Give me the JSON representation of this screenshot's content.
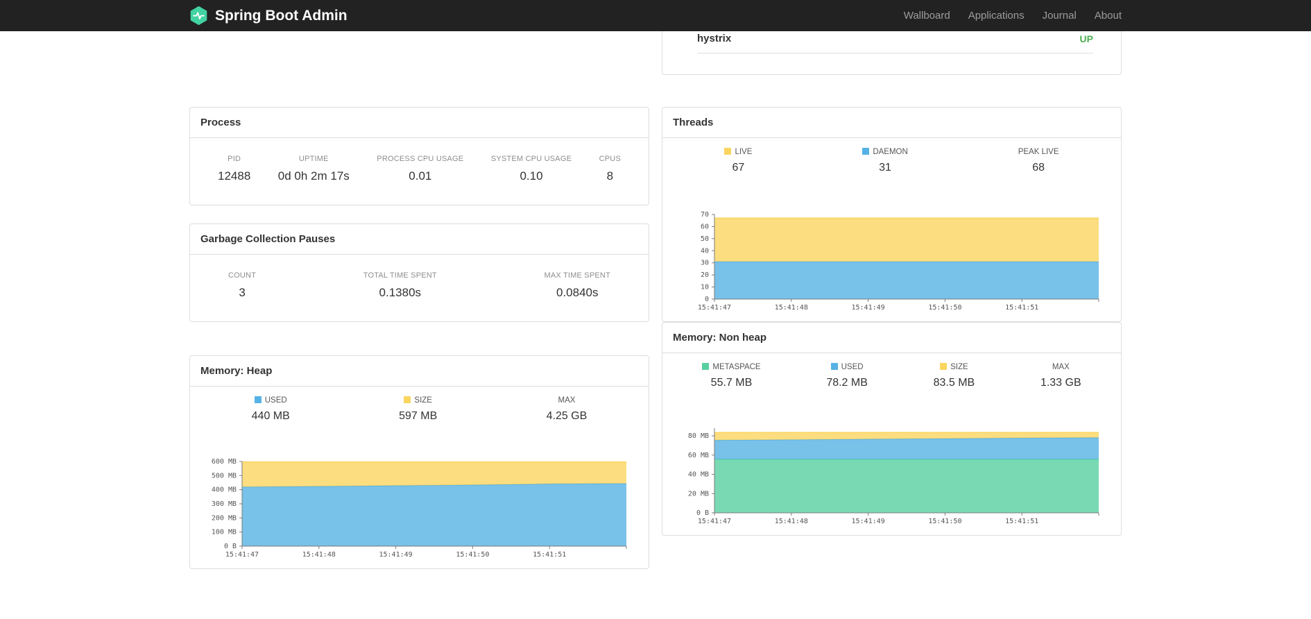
{
  "navbar": {
    "brand": "Spring Boot Admin",
    "links": [
      {
        "label": "Wallboard"
      },
      {
        "label": "Applications"
      },
      {
        "label": "Journal"
      },
      {
        "label": "About"
      }
    ]
  },
  "colors": {
    "navbar_bg": "#222222",
    "logo_green": "#42d3a2",
    "status_up_green": "#4caf50",
    "chart_blue": "#56b2e4",
    "chart_yellow": "#fbd55f",
    "chart_green": "#57d0a0",
    "panel_border": "#dddddd"
  },
  "application": {
    "name": "hystrix",
    "status": "UP",
    "status_color": "#4caf50"
  },
  "panels": {
    "process": {
      "title": "Process",
      "metrics": [
        {
          "label": "PID",
          "value": "12488"
        },
        {
          "label": "UPTIME",
          "value": "0d 0h 2m 17s"
        },
        {
          "label": "PROCESS CPU USAGE",
          "value": "0.01"
        },
        {
          "label": "SYSTEM CPU USAGE",
          "value": "0.10"
        },
        {
          "label": "CPUS",
          "value": "8"
        }
      ]
    },
    "gc": {
      "title": "Garbage Collection Pauses",
      "metrics": [
        {
          "label": "COUNT",
          "value": "3"
        },
        {
          "label": "TOTAL TIME SPENT",
          "value": "0.1380s"
        },
        {
          "label": "MAX TIME SPENT",
          "value": "0.0840s"
        }
      ]
    },
    "threads": {
      "title": "Threads",
      "legend": [
        {
          "label": "LIVE",
          "value": "67",
          "color": "#fbd55f"
        },
        {
          "label": "DAEMON",
          "value": "31",
          "color": "#56b2e4"
        },
        {
          "label": "PEAK LIVE",
          "value": "68"
        }
      ]
    },
    "heap": {
      "title": "Memory: Heap",
      "legend": [
        {
          "label": "USED",
          "value": "440 MB",
          "color": "#56b2e4"
        },
        {
          "label": "SIZE",
          "value": "597 MB",
          "color": "#fbd55f"
        },
        {
          "label": "MAX",
          "value": "4.25 GB"
        }
      ]
    },
    "nonheap": {
      "title": "Memory: Non heap",
      "legend": [
        {
          "label": "METASPACE",
          "value": "55.7 MB",
          "color": "#57d0a0"
        },
        {
          "label": "USED",
          "value": "78.2 MB",
          "color": "#56b2e4"
        },
        {
          "label": "SIZE",
          "value": "83.5 MB",
          "color": "#fbd55f"
        },
        {
          "label": "MAX",
          "value": "1.33 GB"
        }
      ]
    }
  },
  "chart_data": [
    {
      "id": "threads",
      "type": "area",
      "stacked": true,
      "title": "Threads",
      "x_ticks": [
        "15:41:47",
        "15:41:48",
        "15:41:49",
        "15:41:50",
        "15:41:51"
      ],
      "ylim": [
        0,
        70
      ],
      "y_ticks": [
        {
          "v": 0,
          "label": "0"
        },
        {
          "v": 10,
          "label": "10"
        },
        {
          "v": 20,
          "label": "20"
        },
        {
          "v": 30,
          "label": "30"
        },
        {
          "v": 40,
          "label": "40"
        },
        {
          "v": 50,
          "label": "50"
        },
        {
          "v": 60,
          "label": "60"
        },
        {
          "v": 70,
          "label": "70"
        }
      ],
      "series": [
        {
          "name": "DAEMON",
          "color": "#56b2e4",
          "values": [
            31,
            31,
            31,
            31,
            31,
            31
          ]
        },
        {
          "name": "LIVE",
          "color": "#fbd55f",
          "values": [
            67,
            67,
            67,
            67,
            67,
            67
          ]
        }
      ],
      "series_note": "values are stacked totals (LIVE total includes DAEMON)"
    },
    {
      "id": "heap",
      "type": "area",
      "stacked": true,
      "title": "Memory: Heap",
      "x_ticks": [
        "15:41:47",
        "15:41:48",
        "15:41:49",
        "15:41:50",
        "15:41:51"
      ],
      "ylim": [
        0,
        600
      ],
      "y_ticks": [
        {
          "v": 0,
          "label": "0 B"
        },
        {
          "v": 100,
          "label": "100 MB"
        },
        {
          "v": 200,
          "label": "200 MB"
        },
        {
          "v": 300,
          "label": "300 MB"
        },
        {
          "v": 400,
          "label": "400 MB"
        },
        {
          "v": 500,
          "label": "500 MB"
        },
        {
          "v": 600,
          "label": "600 MB"
        }
      ],
      "series": [
        {
          "name": "USED",
          "color": "#56b2e4",
          "values": [
            420,
            424,
            429,
            434,
            441,
            444
          ]
        },
        {
          "name": "SIZE",
          "color": "#fbd55f",
          "values": [
            597,
            597,
            597,
            597,
            597,
            597
          ]
        }
      ],
      "series_note": "values in MB, stacked totals"
    },
    {
      "id": "nonheap",
      "type": "area",
      "stacked": true,
      "title": "Memory: Non heap",
      "x_ticks": [
        "15:41:47",
        "15:41:48",
        "15:41:49",
        "15:41:50",
        "15:41:51"
      ],
      "ylim": [
        0,
        88
      ],
      "y_ticks": [
        {
          "v": 0,
          "label": "0 B"
        },
        {
          "v": 20,
          "label": "20 MB"
        },
        {
          "v": 40,
          "label": "40 MB"
        },
        {
          "v": 60,
          "label": "60 MB"
        },
        {
          "v": 80,
          "label": "80 MB"
        }
      ],
      "series": [
        {
          "name": "METASPACE",
          "color": "#57d0a0",
          "values": [
            55.7,
            55.7,
            55.7,
            55.7,
            55.7,
            55.7
          ]
        },
        {
          "name": "USED",
          "color": "#56b2e4",
          "values": [
            75.5,
            76.0,
            76.6,
            77.2,
            77.8,
            78.2
          ]
        },
        {
          "name": "SIZE",
          "color": "#fbd55f",
          "values": [
            83.5,
            83.5,
            83.5,
            83.5,
            83.5,
            83.5
          ]
        }
      ],
      "series_note": "values in MB, stacked totals"
    }
  ]
}
